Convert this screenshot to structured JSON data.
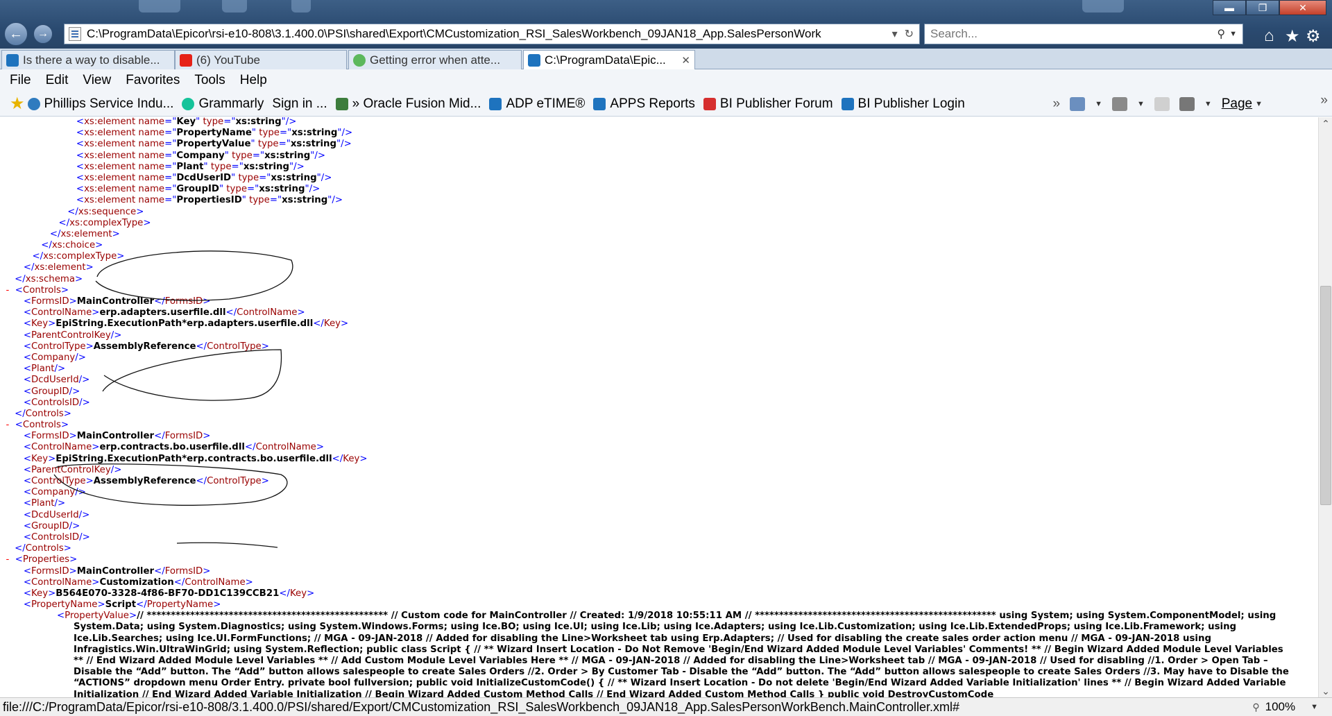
{
  "window": {
    "minimize": "▬",
    "maximize": "❐",
    "close": "✕"
  },
  "nav": {
    "back_icon": "back-arrow-icon",
    "forward_icon": "forward-arrow-icon",
    "address": "C:\\ProgramData\\Epicor\\rsi-e10-808\\3.1.400.0\\PSI\\shared\\Export\\CMCustomization_RSI_SalesWorkbench_09JAN18_App.SalesPersonWork",
    "search_placeholder": "Search...",
    "toolbar_icons": [
      "home-icon",
      "favorites-star-icon",
      "settings-gear-icon"
    ]
  },
  "tabs": [
    {
      "label": "Is there a way to disable...",
      "icon": "ie-icon",
      "color": "#1e73be"
    },
    {
      "label": "(6) YouTube",
      "icon": "youtube-icon",
      "color": "#e62117"
    },
    {
      "label": "Getting error when atte...",
      "icon": "site-icon",
      "color": "#5cb85c"
    },
    {
      "label": "C:\\ProgramData\\Epic...",
      "icon": "ie-icon",
      "color": "#1e73be",
      "active": true,
      "close": "✕"
    }
  ],
  "menu": [
    "File",
    "Edit",
    "View",
    "Favorites",
    "Tools",
    "Help"
  ],
  "favorites": [
    {
      "label": "Phillips Service Indu...",
      "icon": "site-icon",
      "color": "#2f7bbf"
    },
    {
      "label": "Grammarly",
      "icon": "grammarly-icon",
      "color": "#15c39a"
    },
    {
      "label": "Sign in ...",
      "icon": "",
      "color": ""
    },
    {
      "label": "» Oracle Fusion Mid...",
      "icon": "oracle-icon",
      "color": "#3d7d3d"
    },
    {
      "label": "ADP eTIME®",
      "icon": "ie-icon",
      "color": "#1e73be"
    },
    {
      "label": "APPS Reports",
      "icon": "ie-icon",
      "color": "#1e73be"
    },
    {
      "label": "BI Publisher Forum",
      "icon": "oracle-icon",
      "color": "#d62f2f"
    },
    {
      "label": "BI Publisher Login",
      "icon": "ie-icon",
      "color": "#1e73be"
    }
  ],
  "command_bar": {
    "page_label": "Page",
    "chevrons": "»"
  },
  "xml_lines": [
    {
      "indent": 8,
      "open": "xs:element",
      "attrs": [
        [
          "name",
          "Key"
        ],
        [
          "type",
          "xs:string"
        ]
      ],
      "self_close": true
    },
    {
      "indent": 8,
      "open": "xs:element",
      "attrs": [
        [
          "name",
          "PropertyName"
        ],
        [
          "type",
          "xs:string"
        ]
      ],
      "self_close": true
    },
    {
      "indent": 8,
      "open": "xs:element",
      "attrs": [
        [
          "name",
          "PropertyValue"
        ],
        [
          "type",
          "xs:string"
        ]
      ],
      "self_close": true
    },
    {
      "indent": 8,
      "open": "xs:element",
      "attrs": [
        [
          "name",
          "Company"
        ],
        [
          "type",
          "xs:string"
        ]
      ],
      "self_close": true
    },
    {
      "indent": 8,
      "open": "xs:element",
      "attrs": [
        [
          "name",
          "Plant"
        ],
        [
          "type",
          "xs:string"
        ]
      ],
      "self_close": true
    },
    {
      "indent": 8,
      "open": "xs:element",
      "attrs": [
        [
          "name",
          "DcdUserID"
        ],
        [
          "type",
          "xs:string"
        ]
      ],
      "self_close": true
    },
    {
      "indent": 8,
      "open": "xs:element",
      "attrs": [
        [
          "name",
          "GroupID"
        ],
        [
          "type",
          "xs:string"
        ]
      ],
      "self_close": true
    },
    {
      "indent": 8,
      "open": "xs:element",
      "attrs": [
        [
          "name",
          "PropertiesID"
        ],
        [
          "type",
          "xs:string"
        ]
      ],
      "self_close": true
    },
    {
      "indent": 7,
      "close": "xs:sequence"
    },
    {
      "indent": 6,
      "close": "xs:complexType"
    },
    {
      "indent": 5,
      "close": "xs:element"
    },
    {
      "indent": 4,
      "close": "xs:choice"
    },
    {
      "indent": 3,
      "close": "xs:complexType"
    },
    {
      "indent": 2,
      "close": "xs:element"
    },
    {
      "indent": 1,
      "close": "xs:schema"
    },
    {
      "indent": 1,
      "dash": true,
      "open": "Controls"
    },
    {
      "indent": 2,
      "elem": "FormsID",
      "value": "MainController"
    },
    {
      "indent": 2,
      "elem": "ControlName",
      "value": "erp.adapters.userfile.dll"
    },
    {
      "indent": 2,
      "elem": "Key",
      "value": "EpiString.ExecutionPath*erp.adapters.userfile.dll"
    },
    {
      "indent": 2,
      "empty": "ParentControlKey"
    },
    {
      "indent": 2,
      "elem": "ControlType",
      "value": "AssemblyReference"
    },
    {
      "indent": 2,
      "empty": "Company"
    },
    {
      "indent": 2,
      "empty": "Plant"
    },
    {
      "indent": 2,
      "empty": "DcdUserId"
    },
    {
      "indent": 2,
      "empty": "GroupID"
    },
    {
      "indent": 2,
      "empty": "ControlsID"
    },
    {
      "indent": 1,
      "close": "Controls"
    },
    {
      "indent": 1,
      "dash": true,
      "open": "Controls"
    },
    {
      "indent": 2,
      "elem": "FormsID",
      "value": "MainController"
    },
    {
      "indent": 2,
      "elem": "ControlName",
      "value": "erp.contracts.bo.userfile.dll"
    },
    {
      "indent": 2,
      "elem": "Key",
      "value": "EpiString.ExecutionPath*erp.contracts.bo.userfile.dll"
    },
    {
      "indent": 2,
      "empty": "ParentControlKey"
    },
    {
      "indent": 2,
      "elem": "ControlType",
      "value": "AssemblyReference"
    },
    {
      "indent": 2,
      "empty": "Company"
    },
    {
      "indent": 2,
      "empty": "Plant"
    },
    {
      "indent": 2,
      "empty": "DcdUserId"
    },
    {
      "indent": 2,
      "empty": "GroupID"
    },
    {
      "indent": 2,
      "empty": "ControlsID"
    },
    {
      "indent": 1,
      "close": "Controls"
    },
    {
      "indent": 1,
      "dash": true,
      "open": "Properties"
    },
    {
      "indent": 2,
      "elem": "FormsID",
      "value": "MainController"
    },
    {
      "indent": 2,
      "elem": "ControlName",
      "value": "Customization"
    },
    {
      "indent": 2,
      "elem": "Key",
      "value": "B564E070-3328-4f86-BF70-DD1C139CCB21"
    },
    {
      "indent": 2,
      "elem": "PropertyName",
      "value": "Script"
    }
  ],
  "property_value": {
    "tag": "PropertyValue",
    "text": "// ************************************************** // Custom code for MainController // Created: 1/9/2018 10:55:11 AM // ************************************************** using System; using System.ComponentModel; using System.Data; using System.Diagnostics; using System.Windows.Forms; using Ice.BO; using Ice.UI; using Ice.Lib; using Ice.Adapters; using Ice.Lib.Customization; using Ice.Lib.ExtendedProps; using Ice.Lib.Framework; using Ice.Lib.Searches; using Ice.UI.FormFunctions; // MGA - 09-JAN-2018 // Added for disabling the Line>Worksheet tab using Erp.Adapters; // Used for disabling the create sales order action menu // MGA - 09-JAN-2018 using Infragistics.Win.UltraWinGrid; using System.Reflection; public class Script { // ** Wizard Insert Location - Do Not Remove 'Begin/End Wizard Added Module Level Variables' Comments! ** // Begin Wizard Added Module Level Variables ** // End Wizard Added Module Level Variables ** // Add Custom Module Level Variables Here ** // MGA - 09-JAN-2018 // Added for disabling the Line>Worksheet tab // MGA - 09-JAN-2018 // Used for disabling //1. Order > Open Tab – Disable the “Add” button. The “Add” button allows salespeople to create Sales Orders //2. Order > By Customer Tab - Disable the “Add” button. The “Add” button allows salespeople to create Sales Orders //3. May have to Disable the “ACTIONS” dropdown menu Order Entry. private bool fullversion; public void InitializeCustomCode() { // ** Wizard Insert Location - Do not delete 'Begin/End Wizard Added Variable Initialization' lines ** // Begin Wizard Added Variable Initialization // End Wizard Added Variable Initialization // Begin Wizard Added Custom Method Calls // End Wizard Added Custom Method Calls } public void DestroyCustomCode"
  },
  "status": {
    "url": "file:///C:/ProgramData/Epicor/rsi-e10-808/3.1.400.0/PSI/shared/Export/CMCustomization_RSI_SalesWorkbench_09JAN18_App.SalesPersonWorkBench.MainController.xml#",
    "zoom": "100%"
  },
  "colors": {
    "tag": "#990000",
    "attr_value": "#0000ff",
    "collapse_dash": "#ff0000"
  }
}
